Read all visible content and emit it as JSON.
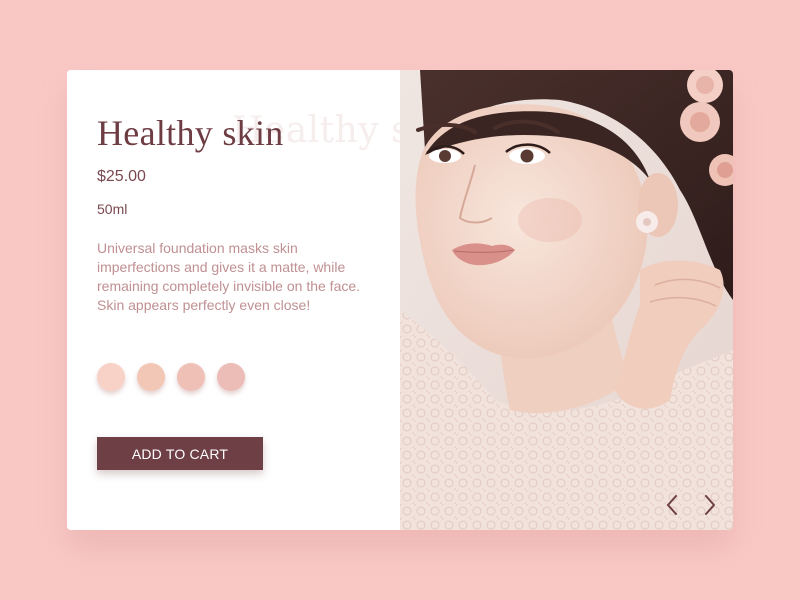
{
  "product": {
    "title": "Healthy skin",
    "title_ghost": "Healthy skin",
    "price": "$25.00",
    "volume": "50ml",
    "description": "Universal foundation masks skin imperfections and gives it a matte, while remaining completely invisible on the face. Skin appears perfectly even close!",
    "add_to_cart_label": "ADD TO CART"
  },
  "shades": [
    {
      "color": "#f8d2c6"
    },
    {
      "color": "#f3c7b5"
    },
    {
      "color": "#efc0b6"
    },
    {
      "color": "#ebbdb6"
    }
  ],
  "gallery": {
    "prev_icon": "chevron-left-icon",
    "next_icon": "chevron-right-icon"
  },
  "colors": {
    "background": "#f9c8c5",
    "accent": "#6e3f44",
    "title": "#6e3d44",
    "description": "#c09092"
  }
}
